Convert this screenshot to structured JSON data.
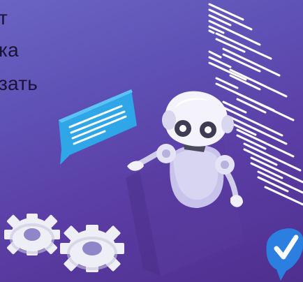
{
  "caption": {
    "lines": [
      "т",
      "ка",
      "зать"
    ]
  },
  "colors": {
    "background_top": "#6a64c4",
    "background_bottom": "#4f2f8e",
    "speech_bubble": "#2fa6e8",
    "check_badge": "#2b7fe0",
    "robot_body": "#e9e7f7",
    "gear": "#eeeef6"
  },
  "icons": {
    "chat": "speech-bubble-icon",
    "check": "check-badge-icon",
    "gears": "gear-icon"
  }
}
